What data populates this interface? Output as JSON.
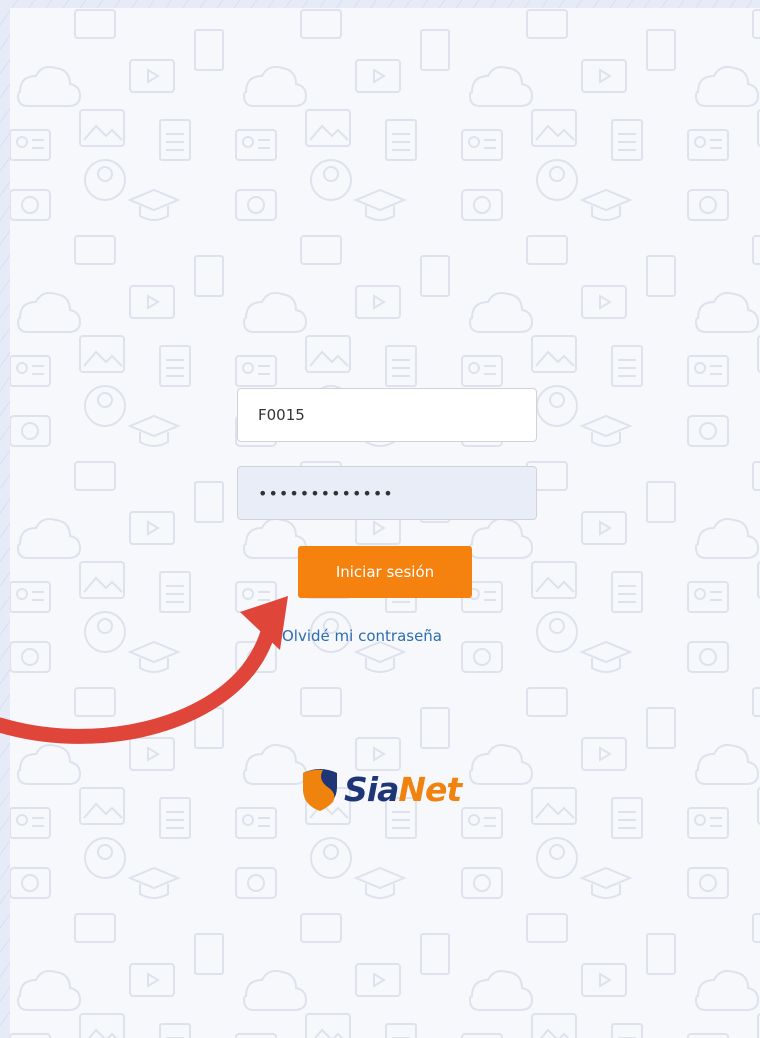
{
  "login": {
    "username_value": "F0015",
    "password_masked": "•••••••••••••",
    "submit_label": "Iniciar sesión",
    "forgot_password_label": "Olvidé mi contraseña"
  },
  "brand": {
    "logo_part1": "Sia",
    "logo_part2": "Net",
    "color_primary": "#1e3576",
    "color_accent": "#f0820e"
  },
  "annotation": {
    "arrow_icon": "curved-arrow-icon",
    "arrow_color": "#e0453a"
  },
  "colors": {
    "button": "#f5820f",
    "link": "#2b6db3",
    "background": "#e7ebf7"
  }
}
